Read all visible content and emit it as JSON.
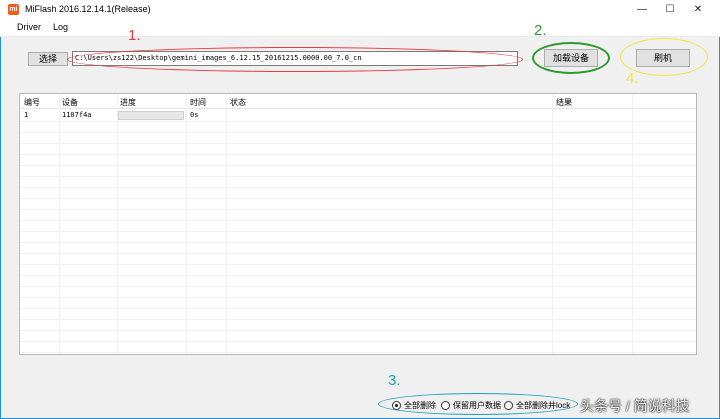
{
  "window": {
    "title": "MiFlash 2016.12.14.1(Release)",
    "app_icon_text": "mi",
    "controls": {
      "minimize": "—",
      "maximize": "☐",
      "close": "✕"
    }
  },
  "menu": {
    "items": [
      "Driver",
      "Log"
    ]
  },
  "toolbar": {
    "select_label": "选择",
    "path_value": "C:\\Users\\zs122\\Desktop\\gemini_images_6.12.15_20161215.0000.00_7.0_cn",
    "load_device_label": "加载设备",
    "flash_label": "刷机"
  },
  "table": {
    "headers": [
      "编号",
      "设备",
      "进度",
      "时间",
      "状态",
      "结果"
    ],
    "rows": [
      {
        "index": "1",
        "device": "1107f4a",
        "progress": 0,
        "time": "0s",
        "status": "",
        "result": ""
      }
    ]
  },
  "options": {
    "selected": 0,
    "items": [
      "全部删除",
      "保留用户数据",
      "全部删除并lock"
    ]
  },
  "annotations": {
    "step1": "1.",
    "step2": "2.",
    "step3": "3.",
    "step4": "4.",
    "colors": {
      "red": "#e83a3a",
      "green": "#2e9a2e",
      "teal": "#1aa0b8",
      "yellow": "#f2e640"
    }
  },
  "watermark": {
    "text": "头条号 / 简说科技"
  },
  "colors": {
    "window_border": "#1f8fe0",
    "progress_fill": "#06b025"
  }
}
